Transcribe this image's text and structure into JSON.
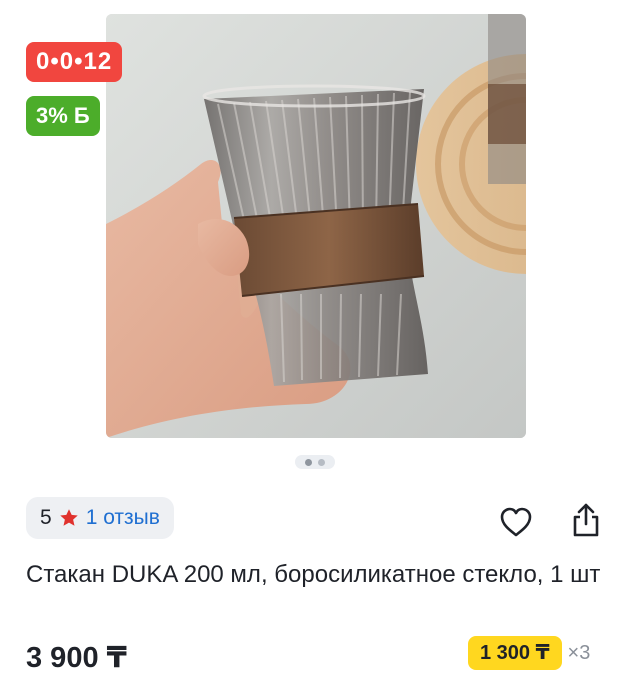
{
  "gallery": {
    "timer": "0•0•12",
    "bonus": "3% Б",
    "slides_total": 2,
    "slide_active": 1
  },
  "rating": {
    "value": "5",
    "reviews_label": "1 отзыв",
    "star_color": "#e0322d"
  },
  "actions": {
    "favorite_icon": "heart-icon",
    "share_icon": "share-icon"
  },
  "product": {
    "title": "Стакан DUKA 200 мл, боросиликатное стекло, 1 шт",
    "price": "3 900 ₸"
  },
  "installment": {
    "amount": "1 300 ₸",
    "times": "×3"
  },
  "colors": {
    "timer_badge": "#f1463f",
    "bonus_badge": "#4cad2a",
    "installment_badge": "#ffd71f",
    "link": "#1f6fd1"
  }
}
